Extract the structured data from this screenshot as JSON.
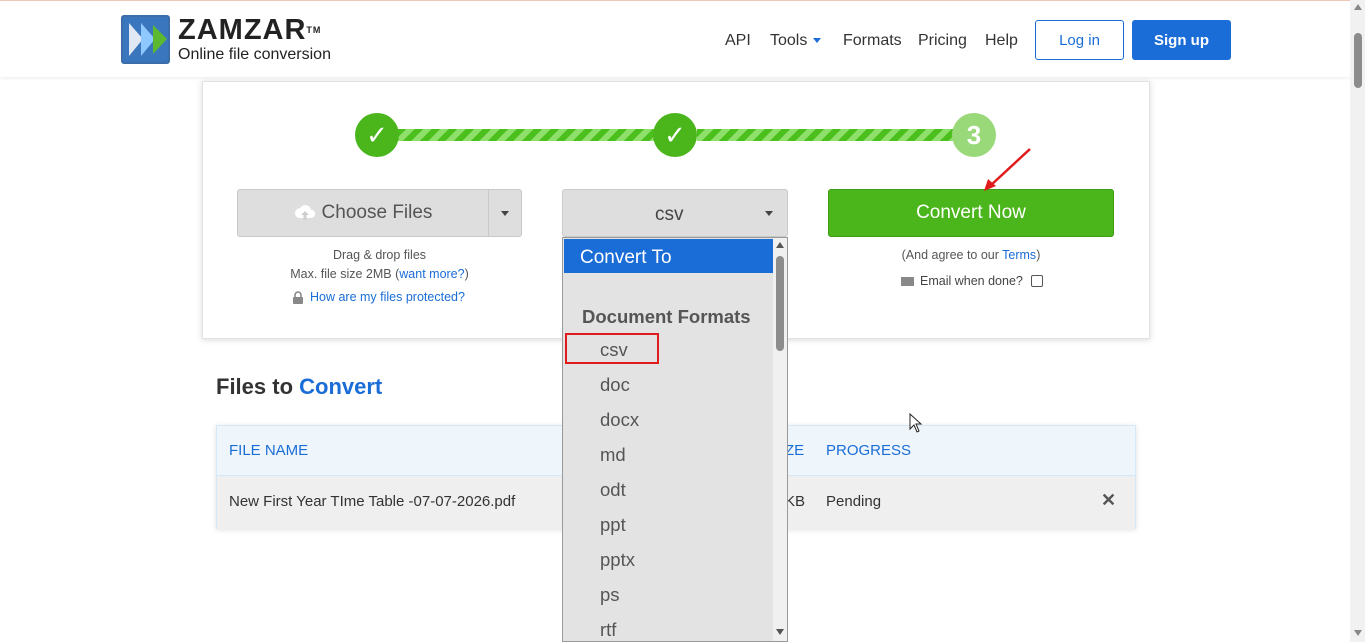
{
  "header": {
    "brand": "ZAMZAR",
    "trademark": "TM",
    "tagline": "Online file conversion",
    "nav": {
      "api": "API",
      "tools": "Tools",
      "formats": "Formats",
      "pricing": "Pricing",
      "help": "Help"
    },
    "login": "Log in",
    "signup": "Sign up"
  },
  "steps": {
    "step1": "✓",
    "step2": "✓",
    "step3": "3"
  },
  "upload": {
    "choose_label": "Choose Files",
    "drag_text": "Drag & drop files",
    "max_size": "Max. file size 2MB (",
    "want_more": "want more?",
    "max_size_end": ")",
    "protected_link": "How are my files protected?"
  },
  "format": {
    "selected": "csv",
    "dropdown_header": "Convert To",
    "group_label": "Document Formats",
    "options": [
      "csv",
      "doc",
      "docx",
      "md",
      "odt",
      "ppt",
      "pptx",
      "ps",
      "rtf"
    ]
  },
  "convert": {
    "button": "Convert Now",
    "agree_prefix": "(And agree to our ",
    "terms": "Terms",
    "agree_suffix": ")",
    "email_label": "Email when done?"
  },
  "files": {
    "title_plain": "Files to ",
    "title_blue": "Convert",
    "columns": {
      "name": "FILE NAME",
      "size_partial": "ZE",
      "progress": "PROGRESS"
    },
    "rows": [
      {
        "name": "New First Year TIme Table -07-07-2026.pdf",
        "size_partial": "KB",
        "progress": "Pending"
      }
    ],
    "remove_icon": "✕"
  },
  "colors": {
    "brand_blue": "#1a6dd7",
    "green": "#4bb51c",
    "highlight_red": "#e01b1b"
  }
}
